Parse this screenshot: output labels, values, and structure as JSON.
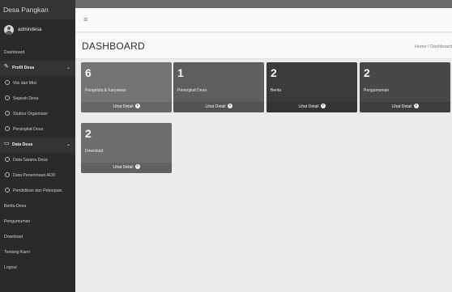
{
  "sidebar": {
    "brand": "Desa Pangkan",
    "user_name": "admindesa",
    "items": [
      {
        "label": "Dashboard",
        "kind": "plain"
      },
      {
        "label": "Profil Desa",
        "kind": "group",
        "icon": "edit-icon"
      },
      {
        "label": "Visi dan Misi",
        "kind": "sub"
      },
      {
        "label": "Sejarah Desa",
        "kind": "sub"
      },
      {
        "label": "Stuktur Organisasi",
        "kind": "sub"
      },
      {
        "label": "Perangkat Desa",
        "kind": "sub"
      },
      {
        "label": "Data Desa",
        "kind": "group",
        "icon": "monitor-icon"
      },
      {
        "label": "Data Sarana Desa",
        "kind": "sub"
      },
      {
        "label": "Data Penerimaan ADD",
        "kind": "sub"
      },
      {
        "label": "Pendidikan dan Pekerjaan",
        "kind": "sub"
      },
      {
        "label": "Berita Desa",
        "kind": "plain"
      },
      {
        "label": "Pengumuman",
        "kind": "plain"
      },
      {
        "label": "Download",
        "kind": "plain"
      },
      {
        "label": "Tentang Kami",
        "kind": "plain"
      },
      {
        "label": "Logout",
        "kind": "plain"
      }
    ]
  },
  "topbar": {
    "menu_icon": "hamburger-icon"
  },
  "header": {
    "title": "DASHBOARD",
    "breadcrumb": "Home / Dashboard"
  },
  "boxes": [
    {
      "count": "6",
      "label": "Pengelola & Karyawan",
      "link": "Lihat Detail"
    },
    {
      "count": "1",
      "label": "Perangkat Desa",
      "link": "Lihat Detail"
    },
    {
      "count": "2",
      "label": "Berita",
      "link": "Lihat Detail"
    },
    {
      "count": "2",
      "label": "Pengumuman",
      "link": "Lihat Detail"
    },
    {
      "count": "2",
      "label": "Download",
      "link": "Lihat Detail"
    }
  ],
  "colors": {
    "sidebar_bg": "#2a2a2a",
    "content_bg": "#ebebeb",
    "box_colors": [
      "#747474",
      "#5e5e5e",
      "#3b3b3b",
      "#484848",
      "#6e6e6e"
    ]
  }
}
